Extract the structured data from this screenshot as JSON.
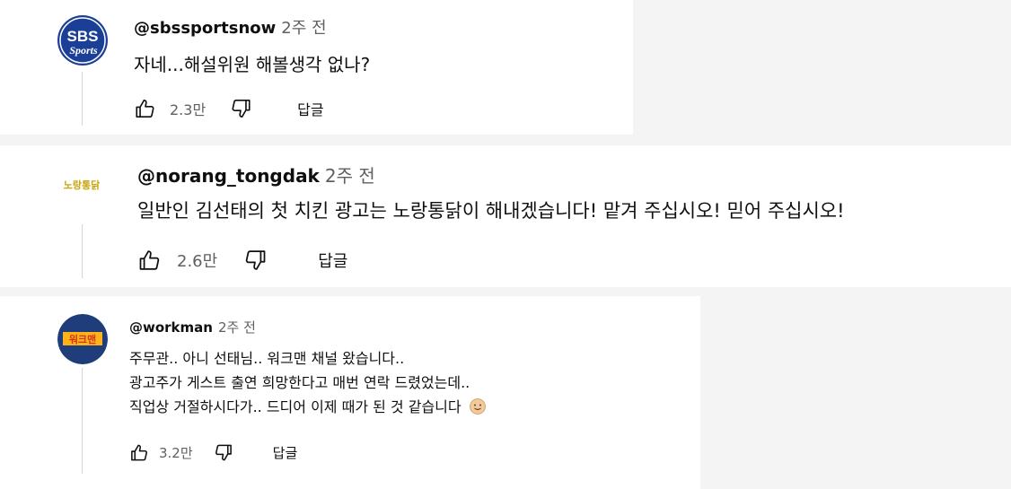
{
  "colors": {
    "text": "#0f0f0f",
    "meta": "#606060",
    "sbs_blue": "#1b3f96",
    "norang_gold": "#c9a50a",
    "workman_bg": "#1f3d7a",
    "workman_text": "#ffb21a"
  },
  "comments": [
    {
      "handle": "@sbssportsnow",
      "time": "2주 전",
      "avatar_icon": "sbs-sports-logo-icon",
      "avatar_logo_lines": [
        "SBS",
        "Sports"
      ],
      "lines": [
        "자네...해설위원 해볼생각 없나?"
      ],
      "likes": "2.3만",
      "reply_label": "답글"
    },
    {
      "handle": "@norang_tongdak",
      "time": "2주 전",
      "avatar_icon": "norang-tongdak-logo-icon",
      "avatar_logo_lines": [
        "노랑통닭"
      ],
      "lines": [
        "일반인 김선태의 첫 치킨 광고는 노랑통닭이 해내겠습니다! 맡겨 주십시오! 믿어 주십시오!"
      ],
      "likes": "2.6만",
      "reply_label": "답글"
    },
    {
      "handle": "@workman",
      "time": "2주 전",
      "avatar_icon": "workman-logo-icon",
      "avatar_logo_lines": [
        "워크맨"
      ],
      "lines": [
        "주무관.. 아니 선태님.. 워크맨 채널 왔습니다..",
        "광고주가 게스트 출연 희망한다고 매번 연락 드렸었는데..",
        "직업상 거절하시다가.. 드디어 이제 때가 된 것 같습니다"
      ],
      "emoji_icon": "smiling-face-emoji-icon",
      "likes": "3.2만",
      "reply_label": "답글"
    }
  ]
}
